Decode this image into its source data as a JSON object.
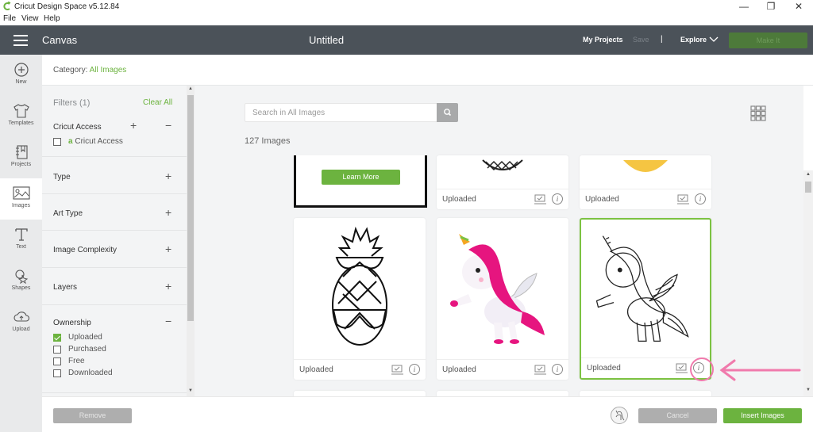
{
  "window": {
    "title": "Cricut Design Space  v5.12.84",
    "controls": [
      "minimize",
      "restore",
      "close"
    ],
    "menu": [
      "File",
      "View",
      "Help"
    ]
  },
  "header": {
    "section": "Canvas",
    "document_title": "Untitled",
    "my_projects": "My Projects",
    "save": "Save",
    "separator": "|",
    "explore": "Explore",
    "make_it": "Make It"
  },
  "leftnav": {
    "items": [
      {
        "label": "New",
        "icon": "plus-circle-icon"
      },
      {
        "label": "Templates",
        "icon": "tshirt-icon"
      },
      {
        "label": "Projects",
        "icon": "notebook-icon"
      },
      {
        "label": "Images",
        "icon": "image-icon",
        "active": true
      },
      {
        "label": "Text",
        "icon": "text-icon"
      },
      {
        "label": "Shapes",
        "icon": "shapes-icon"
      },
      {
        "label": "Upload",
        "icon": "cloud-upload-icon"
      }
    ]
  },
  "category": {
    "label": "Category:",
    "value": "All Images"
  },
  "filters": {
    "title": "Filters (1)",
    "clear_all": "Clear All",
    "cricut_access": {
      "name": "Cricut Access",
      "option": "Cricut Access",
      "checked": false
    },
    "sections": [
      "Type",
      "Art Type",
      "Image Complexity",
      "Layers"
    ],
    "ownership": {
      "name": "Ownership",
      "options": [
        {
          "label": "Uploaded",
          "checked": true
        },
        {
          "label": "Purchased",
          "checked": false
        },
        {
          "label": "Free",
          "checked": false
        },
        {
          "label": "Downloaded",
          "checked": false
        }
      ]
    }
  },
  "main": {
    "search_placeholder": "Search in All Images",
    "count": "127 Images",
    "promo_button": "Learn More",
    "cards": [
      {
        "label": "Uploaded",
        "image": "pineapple-partial"
      },
      {
        "label": "Uploaded",
        "image": "yellow-pineapple-partial"
      },
      {
        "label": "Uploaded",
        "image": "pineapple-sunglasses-outline"
      },
      {
        "label": "Uploaded",
        "image": "pink-unicorn-color"
      },
      {
        "label": "Uploaded",
        "image": "unicorn-outline",
        "selected": true
      }
    ]
  },
  "bottom": {
    "remove": "Remove",
    "cancel": "Cancel",
    "insert": "Insert Images"
  },
  "colors": {
    "accent_green": "#6cb33f",
    "header_bg": "#4b5259",
    "annotation_pink": "#f07aac"
  }
}
